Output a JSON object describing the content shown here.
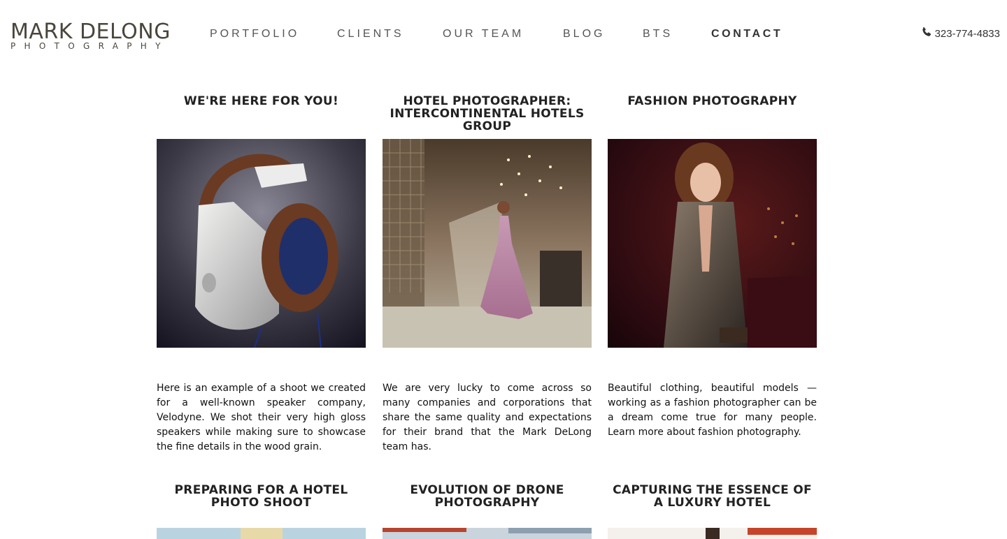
{
  "brand": {
    "name": "MARK DELONG",
    "tagline": "PHOTOGRAPHY"
  },
  "nav": {
    "items": [
      {
        "label": "PORTFOLIO"
      },
      {
        "label": "CLIENTS"
      },
      {
        "label": "OUR TEAM"
      },
      {
        "label": "BLOG"
      },
      {
        "label": "BTS"
      },
      {
        "label": "CONTACT",
        "active": true
      }
    ]
  },
  "phone": {
    "icon": "phone-icon",
    "number": "323-774-4833"
  },
  "posts": [
    {
      "title": "WE'RE HERE FOR YOU!",
      "image": "headphones-product-photo",
      "excerpt": "Here is an example of a shoot we created for a well-known speaker company, Velodyne. We shot their very high gloss speakers while making sure to showcase the fine details in the wood grain."
    },
    {
      "title": "HOTEL PHOTOGRAPHER: INTERCONTINENTAL HOTELS GROUP",
      "image": "hotel-lobby-model-photo",
      "excerpt": "We are very lucky to come across so many companies and corporations that share the same quality and expectations for their brand that the Mark DeLong team has."
    },
    {
      "title": "FASHION PHOTOGRAPHY",
      "image": "fashion-model-photo",
      "excerpt": "Beautiful clothing, beautiful models — working as a fashion photographer can be a dream come true for many people.",
      "link": "Learn more about fashion photography."
    },
    {
      "title": "PREPARING FOR A HOTEL PHOTO SHOOT",
      "image": "hotel-photo-shoot-preview"
    },
    {
      "title": "EVOLUTION OF DRONE PHOTOGRAPHY",
      "image": "drone-photography-preview"
    },
    {
      "title": "CAPTURING THE ESSENCE OF A LUXURY HOTEL",
      "image": "luxury-hotel-preview"
    }
  ],
  "colors": {
    "logo": "#4a463c",
    "nav_text": "#555555",
    "background": "#ffffff"
  }
}
